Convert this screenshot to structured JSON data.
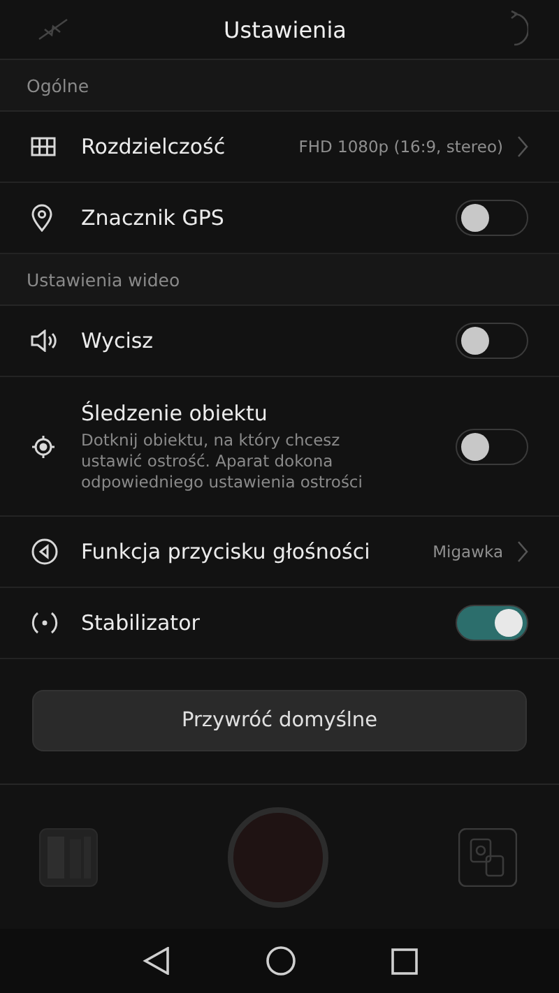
{
  "header": {
    "title": "Ustawienia"
  },
  "sections": [
    {
      "title": "Ogólne",
      "items": [
        {
          "kind": "value",
          "label": "Rozdzielczość",
          "value": "FHD 1080p (16:9, stereo)"
        },
        {
          "kind": "toggle",
          "label": "Znacznik GPS",
          "on": false
        }
      ]
    },
    {
      "title": "Ustawienia wideo",
      "items": [
        {
          "kind": "toggle",
          "label": "Wycisz",
          "on": false
        },
        {
          "kind": "toggle",
          "label": "Śledzenie obiektu",
          "description": "Dotknij obiektu, na który chcesz ustawić ostrość. Aparat dokona odpowiedniego ustawienia ostrości",
          "on": false
        },
        {
          "kind": "value",
          "label": "Funkcja przycisku głośności",
          "value": "Migawka"
        },
        {
          "kind": "toggle",
          "label": "Stabilizator",
          "on": true
        }
      ]
    }
  ],
  "reset_button": {
    "label": "Przywróć domyślne"
  }
}
